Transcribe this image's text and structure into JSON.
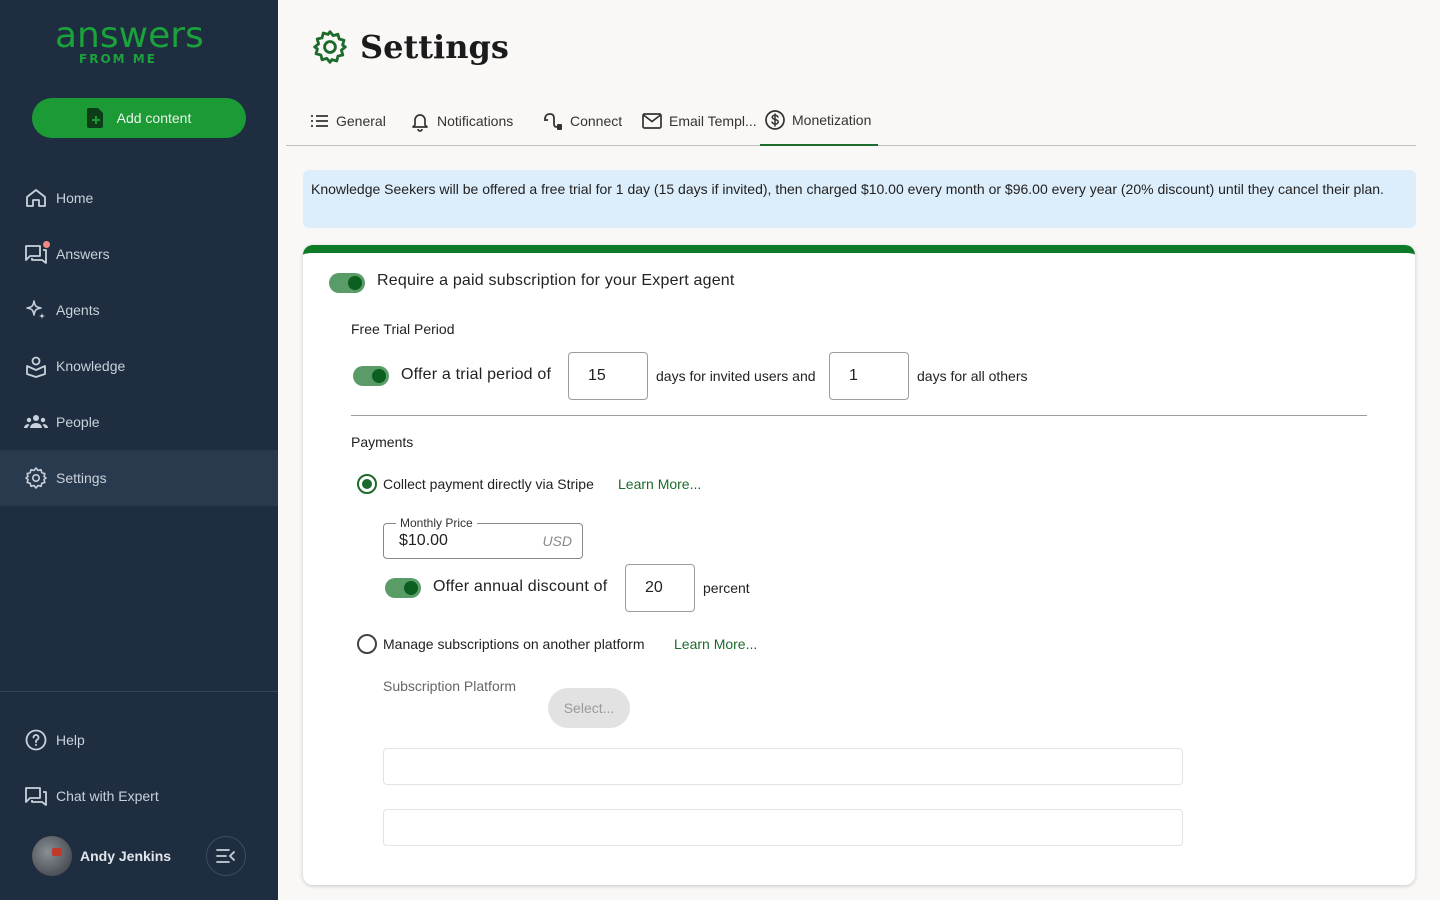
{
  "brand": {
    "name": "answers",
    "tagline": "FROM ME",
    "color": "#1aa33a"
  },
  "sidebar": {
    "add_button": "Add content",
    "items": [
      {
        "label": "Home",
        "icon": "home-icon"
      },
      {
        "label": "Answers",
        "icon": "chat-icon",
        "has_badge": true
      },
      {
        "label": "Agents",
        "icon": "sparkle-icon"
      },
      {
        "label": "Knowledge",
        "icon": "knowledge-icon"
      },
      {
        "label": "People",
        "icon": "people-icon"
      },
      {
        "label": "Settings",
        "icon": "gear-icon",
        "active": true
      }
    ],
    "bottom_items": [
      {
        "label": "Help",
        "icon": "help-icon"
      },
      {
        "label": "Chat with Expert",
        "icon": "chat-icon"
      }
    ],
    "user": {
      "name": "Andy Jenkins"
    }
  },
  "header": {
    "title": "Settings"
  },
  "tabs": [
    {
      "label": "General",
      "icon": "list-icon"
    },
    {
      "label": "Notifications",
      "icon": "bell-icon"
    },
    {
      "label": "Connect",
      "icon": "connect-icon"
    },
    {
      "label": "Email Templ...",
      "icon": "mail-icon"
    },
    {
      "label": "Monetization",
      "icon": "dollar-icon",
      "active": true
    }
  ],
  "info_banner": "Knowledge Seekers will be offered a free trial for 1 day (15 days if invited), then charged $10.00 every month or $96.00 every year (20% discount) until they cancel their plan.",
  "monetization": {
    "require_subscription": {
      "enabled": true,
      "label": "Require a paid subscription for your Expert agent"
    },
    "free_trial": {
      "section_title": "Free Trial Period",
      "enabled": true,
      "label_prefix": "Offer a trial period of",
      "invited_days": "15",
      "label_middle": "days for invited users and",
      "other_days": "1",
      "label_suffix": "days for all others"
    },
    "payments": {
      "section_title": "Payments",
      "stripe": {
        "selected": true,
        "label": "Collect payment directly via Stripe",
        "link": "Learn More..."
      },
      "monthly_price": {
        "legend": "Monthly Price",
        "value": "$10.00",
        "currency": "USD"
      },
      "annual_discount": {
        "enabled": true,
        "label": "Offer annual discount of",
        "value": "20",
        "suffix": "percent"
      },
      "other_platform": {
        "selected": false,
        "label": "Manage subscriptions on another platform",
        "link": "Learn More..."
      },
      "subscription_platform": {
        "label": "Subscription Platform",
        "placeholder": "Select..."
      }
    }
  },
  "colors": {
    "accent": "#1d6b2c",
    "sidebar_bg": "#1e2d40",
    "info_bg": "#dcedfb",
    "card_top": "#0d7a27"
  }
}
